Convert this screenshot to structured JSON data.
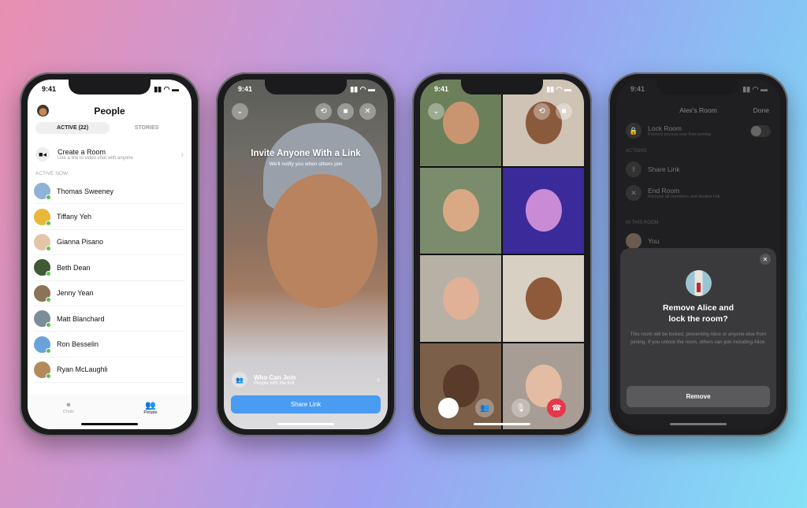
{
  "status_time": "9:41",
  "people_screen": {
    "title": "People",
    "tabs": [
      "ACTIVE (22)",
      "STORIES"
    ],
    "create_room": {
      "title": "Create a Room",
      "subtitle": "Use a link to video chat with anyone"
    },
    "section": "ACTIVE NOW",
    "people": [
      "Thomas Sweeney",
      "Tiffany Yeh",
      "Gianna Pisano",
      "Beth Dean",
      "Jenny Yean",
      "Matt Blanchard",
      "Ron Besselin",
      "Ryan McLaughli"
    ],
    "nav": [
      "Chats",
      "People"
    ],
    "online_color": "#5ac04a"
  },
  "invite_screen": {
    "title": "Invite Anyone With a Link",
    "subtitle": "We'll notify you when others join",
    "who_title": "Who Can Join",
    "who_subtitle": "People with the link",
    "share_button": "Share Link",
    "accent": "#4a9cf3"
  },
  "room_screen": {
    "title": "Alex's Room",
    "done": "Done",
    "lock": {
      "title": "Lock Room",
      "subtitle": "Prevent anyone else from joining",
      "enabled": false
    },
    "actions_label": "ACTIONS",
    "share": "Share Link",
    "end": {
      "title": "End Room",
      "subtitle": "Remove all members and disable link"
    },
    "in_room_label": "IN THIS ROOM",
    "member": "You",
    "dialog": {
      "title_line1": "Remove Alice and",
      "title_line2": "lock the room?",
      "body": "This room will be locked, preventing Alice or anyone else from joining. If you unlock the room, others can join including Alice.",
      "button": "Remove"
    }
  }
}
